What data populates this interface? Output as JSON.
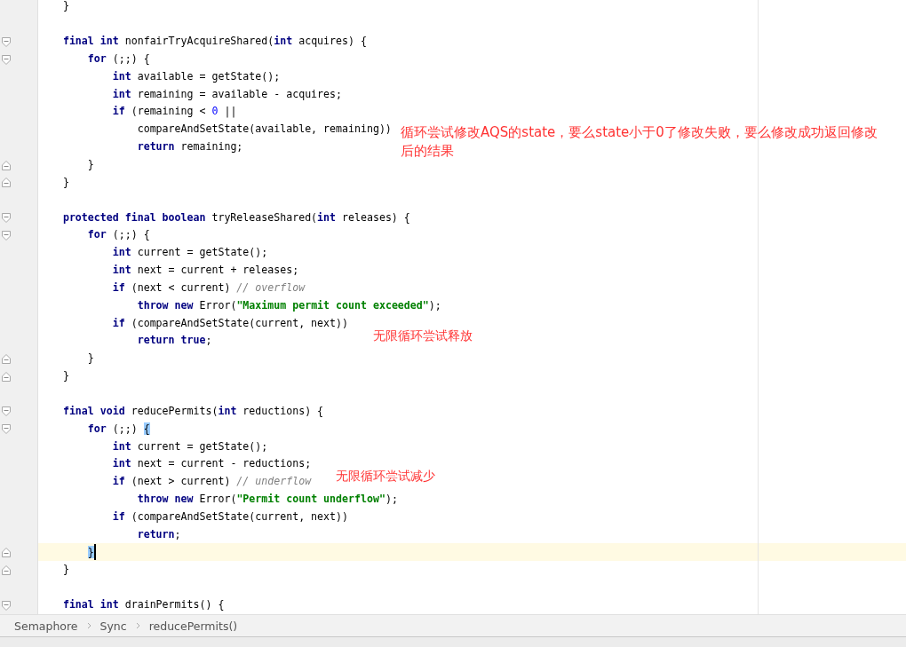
{
  "editor": {
    "lines": [
      {
        "kind": "code",
        "tokens": [
          {
            "kind": "plain",
            "text": "}"
          }
        ]
      },
      {
        "kind": "blank"
      },
      {
        "kind": "code",
        "fold_open": true,
        "tokens": [
          {
            "kind": "keyword",
            "text": "final int"
          },
          {
            "kind": "plain",
            "text": " nonfairTryAcquireShared("
          },
          {
            "kind": "keyword",
            "text": "int"
          },
          {
            "kind": "plain",
            "text": " acquires) {"
          }
        ],
        "children": [
          {
            "kind": "code",
            "fold_open": true,
            "tokens": [
              {
                "kind": "keyword",
                "text": "for"
              },
              {
                "kind": "plain",
                "text": " (;;) {"
              }
            ],
            "children": [
              {
                "kind": "code",
                "tokens": [
                  {
                    "kind": "keyword",
                    "text": "int"
                  },
                  {
                    "kind": "plain",
                    "text": " available = getState();"
                  }
                ]
              },
              {
                "kind": "code",
                "tokens": [
                  {
                    "kind": "keyword",
                    "text": "int"
                  },
                  {
                    "kind": "plain",
                    "text": " remaining = available - acquires;"
                  }
                ]
              },
              {
                "kind": "code",
                "tokens": [
                  {
                    "kind": "keyword",
                    "text": "if"
                  },
                  {
                    "kind": "plain",
                    "text": " (remaining < "
                  },
                  {
                    "kind": "number",
                    "text": "0"
                  },
                  {
                    "kind": "plain",
                    "text": " ||"
                  }
                ],
                "children": [
                  {
                    "kind": "code",
                    "tokens": [
                      {
                        "kind": "plain",
                        "text": "compareAndSetState(available, remaining))"
                      }
                    ]
                  },
                  {
                    "kind": "code",
                    "tokens": [
                      {
                        "kind": "keyword",
                        "text": "return"
                      },
                      {
                        "kind": "plain",
                        "text": " remaining;"
                      }
                    ]
                  }
                ]
              }
            ]
          },
          {
            "kind": "code",
            "fold_close": true,
            "tokens": [
              {
                "kind": "plain",
                "text": "}"
              }
            ]
          }
        ]
      },
      {
        "kind": "code",
        "fold_close": true,
        "tokens": [
          {
            "kind": "plain",
            "text": "}"
          }
        ]
      },
      {
        "kind": "blank"
      },
      {
        "kind": "code",
        "fold_open": true,
        "tokens": [
          {
            "kind": "keyword",
            "text": "protected final boolean"
          },
          {
            "kind": "plain",
            "text": " tryReleaseShared("
          },
          {
            "kind": "keyword",
            "text": "int"
          },
          {
            "kind": "plain",
            "text": " releases) {"
          }
        ],
        "children": [
          {
            "kind": "code",
            "fold_open": true,
            "tokens": [
              {
                "kind": "keyword",
                "text": "for"
              },
              {
                "kind": "plain",
                "text": " (;;) {"
              }
            ],
            "children": [
              {
                "kind": "code",
                "tokens": [
                  {
                    "kind": "keyword",
                    "text": "int"
                  },
                  {
                    "kind": "plain",
                    "text": " current = getState();"
                  }
                ]
              },
              {
                "kind": "code",
                "tokens": [
                  {
                    "kind": "keyword",
                    "text": "int"
                  },
                  {
                    "kind": "plain",
                    "text": " next = current + releases;"
                  }
                ]
              },
              {
                "kind": "code",
                "tokens": [
                  {
                    "kind": "keyword",
                    "text": "if"
                  },
                  {
                    "kind": "plain",
                    "text": " (next < current) "
                  },
                  {
                    "kind": "comment",
                    "text": "// overflow"
                  }
                ],
                "children": [
                  {
                    "kind": "code",
                    "tokens": [
                      {
                        "kind": "keyword",
                        "text": "throw new"
                      },
                      {
                        "kind": "plain",
                        "text": " Error("
                      },
                      {
                        "kind": "string",
                        "text": "\"Maximum permit count exceeded\""
                      },
                      {
                        "kind": "plain",
                        "text": ");"
                      }
                    ]
                  }
                ]
              },
              {
                "kind": "code",
                "tokens": [
                  {
                    "kind": "keyword",
                    "text": "if"
                  },
                  {
                    "kind": "plain",
                    "text": " (compareAndSetState(current, next))"
                  }
                ],
                "children": [
                  {
                    "kind": "code",
                    "tokens": [
                      {
                        "kind": "keyword",
                        "text": "return true"
                      },
                      {
                        "kind": "plain",
                        "text": ";"
                      }
                    ]
                  }
                ]
              }
            ]
          },
          {
            "kind": "code",
            "fold_close": true,
            "tokens": [
              {
                "kind": "plain",
                "text": "}"
              }
            ]
          }
        ]
      },
      {
        "kind": "code",
        "fold_close": true,
        "tokens": [
          {
            "kind": "plain",
            "text": "}"
          }
        ]
      },
      {
        "kind": "blank"
      },
      {
        "kind": "code",
        "fold_open": true,
        "tokens": [
          {
            "kind": "keyword",
            "text": "final void"
          },
          {
            "kind": "plain",
            "text": " reducePermits("
          },
          {
            "kind": "keyword",
            "text": "int"
          },
          {
            "kind": "plain",
            "text": " reductions) {"
          }
        ],
        "children": [
          {
            "kind": "code",
            "fold_open": true,
            "tokens": [
              {
                "kind": "keyword",
                "text": "for"
              },
              {
                "kind": "plain",
                "text": " (;;) "
              },
              {
                "kind": "brace",
                "text": "{"
              }
            ],
            "children": [
              {
                "kind": "code",
                "tokens": [
                  {
                    "kind": "keyword",
                    "text": "int"
                  },
                  {
                    "kind": "plain",
                    "text": " current = getState();"
                  }
                ]
              },
              {
                "kind": "code",
                "tokens": [
                  {
                    "kind": "keyword",
                    "text": "int"
                  },
                  {
                    "kind": "plain",
                    "text": " next = current - reductions;"
                  }
                ]
              },
              {
                "kind": "code",
                "tokens": [
                  {
                    "kind": "keyword",
                    "text": "if"
                  },
                  {
                    "kind": "plain",
                    "text": " (next > current) "
                  },
                  {
                    "kind": "comment",
                    "text": "// underflow"
                  }
                ],
                "children": [
                  {
                    "kind": "code",
                    "tokens": [
                      {
                        "kind": "keyword",
                        "text": "throw new"
                      },
                      {
                        "kind": "plain",
                        "text": " Error("
                      },
                      {
                        "kind": "string",
                        "text": "\"Permit count underflow\""
                      },
                      {
                        "kind": "plain",
                        "text": ");"
                      }
                    ]
                  }
                ]
              },
              {
                "kind": "code",
                "tokens": [
                  {
                    "kind": "keyword",
                    "text": "if"
                  },
                  {
                    "kind": "plain",
                    "text": " (compareAndSetState(current, next))"
                  }
                ],
                "children": [
                  {
                    "kind": "code",
                    "tokens": [
                      {
                        "kind": "keyword",
                        "text": "return"
                      },
                      {
                        "kind": "plain",
                        "text": ";"
                      }
                    ]
                  }
                ]
              }
            ]
          },
          {
            "kind": "code",
            "fold_close": true,
            "current": true,
            "tokens": [
              {
                "kind": "brace",
                "text": "}"
              }
            ]
          }
        ]
      },
      {
        "kind": "code",
        "fold_close": true,
        "tokens": [
          {
            "kind": "plain",
            "text": "}"
          }
        ]
      },
      {
        "kind": "blank"
      },
      {
        "kind": "code",
        "fold_open": true,
        "tokens": [
          {
            "kind": "keyword",
            "text": "final int"
          },
          {
            "kind": "plain",
            "text": " drainPermits() {"
          }
        ]
      }
    ],
    "annotations": [
      "循环尝试修改AQS的state，要么state小于0了修改失败，要么修改成功返回修改后的结果",
      "无限循环尝试释放",
      "无限循环尝试减少"
    ]
  },
  "breadcrumbs": [
    "Semaphore",
    "Sync",
    "reducePermits()"
  ]
}
